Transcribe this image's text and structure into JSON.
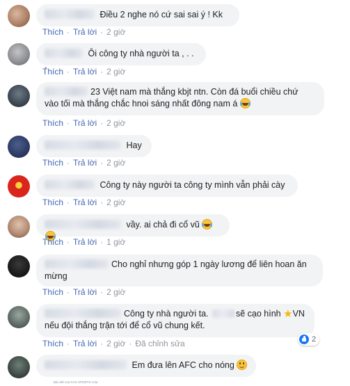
{
  "actions": {
    "like": "Thích",
    "reply": "Trả lời",
    "edited": "Đã chỉnh sửa"
  },
  "comments": [
    {
      "text": "Điều 2 nghe nó cứ sai sai ý ! Kk",
      "time": "2 giờ"
    },
    {
      "text": "Ôi công ty nhà người ta , . . .",
      "time": "2 giờ"
    },
    {
      "text_line1": "23 Việt nam mà thắng kbjt ntn. Còn đá buổi chiều chứ",
      "text_line2": "vào tối mà thắng chắc hnoi sáng nhất đông nam á",
      "time": "2 giờ"
    },
    {
      "text": "Hay",
      "time": "2 giờ"
    },
    {
      "text": "Công ty này người ta công ty mình vẫn phải cày",
      "time": "2 giờ"
    },
    {
      "text": "vầy. ai chả đi cổ vũ",
      "time": "1 giờ"
    },
    {
      "text_line1": "Cho nghỉ nhưng góp 1 ngày lương để liên hoan ăn",
      "text_line2": "mừng",
      "time": "2 giờ"
    },
    {
      "text_part1": "Công ty nhà người ta.",
      "text_part2": "sẽ cạo hình",
      "text_part3": "VN",
      "text_line2": "nếu đội thắng trận tới để cổ vũ chung kết.",
      "time": "2 giờ",
      "reaction_count": "2"
    },
    {
      "text": "Em đưa lên AFC cho nóng"
    }
  ],
  "source_caption": "Bài viết của FOX SPORTS Asia",
  "icons": {
    "laugh": "laughing-tears-emoji",
    "smile": "smiling-emoji",
    "star": "star-emoji",
    "like": "like-thumb-badge"
  },
  "colors": {
    "link": "#4267b2",
    "bubble": "#f2f3f5",
    "meta": "#90949c"
  }
}
